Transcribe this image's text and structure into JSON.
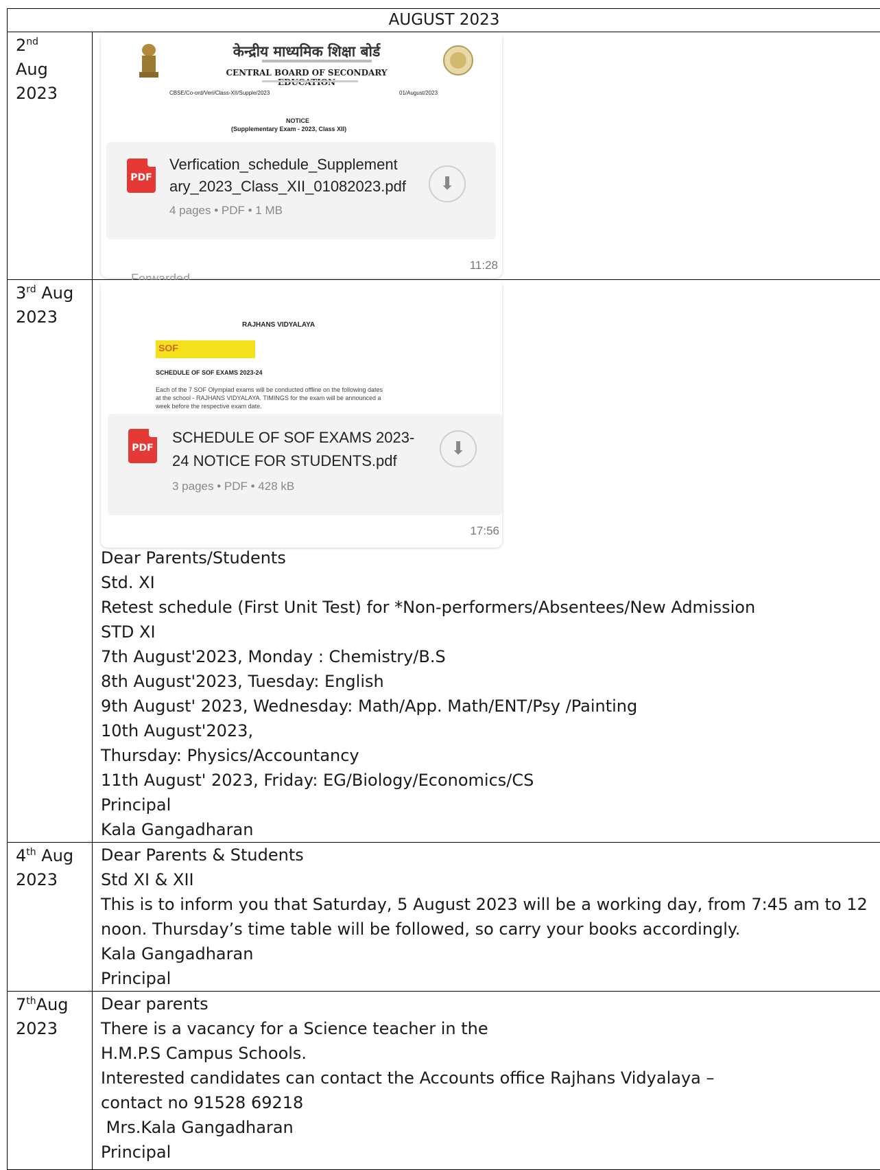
{
  "header": {
    "title": "AUGUST 2023"
  },
  "rows": [
    {
      "day": "2",
      "suffix": "nd",
      "month": "Aug",
      "year": "2023"
    },
    {
      "day": "3",
      "suffix": "rd",
      "month": "Aug",
      "year": "2023"
    },
    {
      "day": "4",
      "suffix": "th",
      "month": "Aug",
      "year": "2023"
    },
    {
      "day": "7",
      "suffix": "th",
      "month": "Aug",
      "year": "2023"
    }
  ],
  "card1": {
    "hindi_title": "केन्द्रीय माध्यमिक शिक्षा बोर्ड",
    "english_title": "CENTRAL BOARD OF SECONDARY EDUCATION",
    "ref": "CBSE/Co-ord/Veri/Class-XII/Supple/2023",
    "date": "01/August/2023",
    "notice": "NOTICE",
    "notice_sub": "(Supplementary Exam - 2023, Class XII)",
    "file_line1": "Verfication_schedule_Supplement",
    "file_line2": "ary_2023_Class_XII_01082023.pdf",
    "meta": "4 pages • PDF • 1 MB",
    "pdf_label": "PDF",
    "time": "11:28"
  },
  "card2": {
    "forwarded": "Forwarded",
    "school": "RAJHANS VIDYALAYA",
    "sof": "SOF",
    "heading": "SCHEDULE OF SOF EXAMS 2023-24",
    "body1": "Each of the 7 SOF Olympiad exams will be conducted offline on the following dates",
    "body2": "at the school - RAJHANS VIDYALAYA. TIMINGS for the exam will be announced a",
    "body3": "week before the respective exam date.",
    "file_line1": "SCHEDULE OF SOF EXAMS 2023-",
    "file_line2": "24 NOTICE FOR STUDENTS.pdf",
    "meta": "3 pages • PDF • 428 kB",
    "pdf_label": "PDF",
    "time": "17:56"
  },
  "msg3": [
    "Dear Parents/Students",
    "Std. XI",
    "Retest schedule (First Unit Test) for *Non-performers/Absentees/New Admission",
    "STD XI",
    "7th August'2023, Monday : Chemistry/B.S",
    "8th August'2023, Tuesday: English",
    "9th August' 2023, Wednesday: Math/App. Math/ENT/Psy /Painting",
    "10th August'2023,",
    "Thursday: Physics/Accountancy",
    "11th August' 2023, Friday: EG/Biology/Economics/CS",
    "Principal",
    "Kala Gangadharan"
  ],
  "msg4": [
    "Dear Parents & Students",
    "Std XI & XII",
    "This is to inform you that Saturday, 5 August 2023 will be a working day, from 7:45 am to 12 noon. Thursday’s time table will be followed, so carry your books accordingly.",
    "Kala Gangadharan",
    "Principal"
  ],
  "msg7": [
    "Dear parents",
    "There is a vacancy for a Science teacher in the",
    "H.M.P.S Campus Schools.",
    "Interested candidates can contact the Accounts office Rajhans Vidyalaya –",
    "contact no 91528 69218",
    " Mrs.Kala Gangadharan",
    "Principal"
  ]
}
